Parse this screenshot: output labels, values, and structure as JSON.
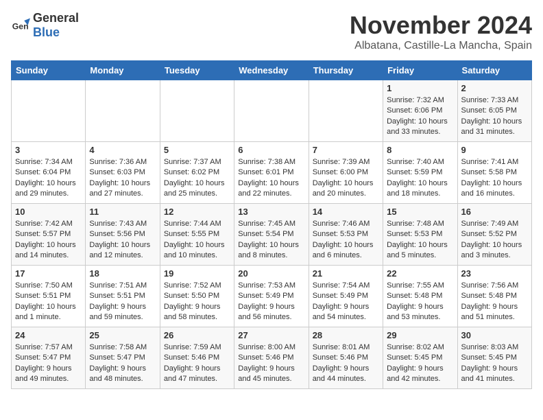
{
  "logo": {
    "general": "General",
    "blue": "Blue"
  },
  "header": {
    "month": "November 2024",
    "location": "Albatana, Castille-La Mancha, Spain"
  },
  "weekdays": [
    "Sunday",
    "Monday",
    "Tuesday",
    "Wednesday",
    "Thursday",
    "Friday",
    "Saturday"
  ],
  "weeks": [
    [
      {
        "day": "",
        "info": ""
      },
      {
        "day": "",
        "info": ""
      },
      {
        "day": "",
        "info": ""
      },
      {
        "day": "",
        "info": ""
      },
      {
        "day": "",
        "info": ""
      },
      {
        "day": "1",
        "info": "Sunrise: 7:32 AM\nSunset: 6:06 PM\nDaylight: 10 hours and 33 minutes."
      },
      {
        "day": "2",
        "info": "Sunrise: 7:33 AM\nSunset: 6:05 PM\nDaylight: 10 hours and 31 minutes."
      }
    ],
    [
      {
        "day": "3",
        "info": "Sunrise: 7:34 AM\nSunset: 6:04 PM\nDaylight: 10 hours and 29 minutes."
      },
      {
        "day": "4",
        "info": "Sunrise: 7:36 AM\nSunset: 6:03 PM\nDaylight: 10 hours and 27 minutes."
      },
      {
        "day": "5",
        "info": "Sunrise: 7:37 AM\nSunset: 6:02 PM\nDaylight: 10 hours and 25 minutes."
      },
      {
        "day": "6",
        "info": "Sunrise: 7:38 AM\nSunset: 6:01 PM\nDaylight: 10 hours and 22 minutes."
      },
      {
        "day": "7",
        "info": "Sunrise: 7:39 AM\nSunset: 6:00 PM\nDaylight: 10 hours and 20 minutes."
      },
      {
        "day": "8",
        "info": "Sunrise: 7:40 AM\nSunset: 5:59 PM\nDaylight: 10 hours and 18 minutes."
      },
      {
        "day": "9",
        "info": "Sunrise: 7:41 AM\nSunset: 5:58 PM\nDaylight: 10 hours and 16 minutes."
      }
    ],
    [
      {
        "day": "10",
        "info": "Sunrise: 7:42 AM\nSunset: 5:57 PM\nDaylight: 10 hours and 14 minutes."
      },
      {
        "day": "11",
        "info": "Sunrise: 7:43 AM\nSunset: 5:56 PM\nDaylight: 10 hours and 12 minutes."
      },
      {
        "day": "12",
        "info": "Sunrise: 7:44 AM\nSunset: 5:55 PM\nDaylight: 10 hours and 10 minutes."
      },
      {
        "day": "13",
        "info": "Sunrise: 7:45 AM\nSunset: 5:54 PM\nDaylight: 10 hours and 8 minutes."
      },
      {
        "day": "14",
        "info": "Sunrise: 7:46 AM\nSunset: 5:53 PM\nDaylight: 10 hours and 6 minutes."
      },
      {
        "day": "15",
        "info": "Sunrise: 7:48 AM\nSunset: 5:53 PM\nDaylight: 10 hours and 5 minutes."
      },
      {
        "day": "16",
        "info": "Sunrise: 7:49 AM\nSunset: 5:52 PM\nDaylight: 10 hours and 3 minutes."
      }
    ],
    [
      {
        "day": "17",
        "info": "Sunrise: 7:50 AM\nSunset: 5:51 PM\nDaylight: 10 hours and 1 minute."
      },
      {
        "day": "18",
        "info": "Sunrise: 7:51 AM\nSunset: 5:51 PM\nDaylight: 9 hours and 59 minutes."
      },
      {
        "day": "19",
        "info": "Sunrise: 7:52 AM\nSunset: 5:50 PM\nDaylight: 9 hours and 58 minutes."
      },
      {
        "day": "20",
        "info": "Sunrise: 7:53 AM\nSunset: 5:49 PM\nDaylight: 9 hours and 56 minutes."
      },
      {
        "day": "21",
        "info": "Sunrise: 7:54 AM\nSunset: 5:49 PM\nDaylight: 9 hours and 54 minutes."
      },
      {
        "day": "22",
        "info": "Sunrise: 7:55 AM\nSunset: 5:48 PM\nDaylight: 9 hours and 53 minutes."
      },
      {
        "day": "23",
        "info": "Sunrise: 7:56 AM\nSunset: 5:48 PM\nDaylight: 9 hours and 51 minutes."
      }
    ],
    [
      {
        "day": "24",
        "info": "Sunrise: 7:57 AM\nSunset: 5:47 PM\nDaylight: 9 hours and 49 minutes."
      },
      {
        "day": "25",
        "info": "Sunrise: 7:58 AM\nSunset: 5:47 PM\nDaylight: 9 hours and 48 minutes."
      },
      {
        "day": "26",
        "info": "Sunrise: 7:59 AM\nSunset: 5:46 PM\nDaylight: 9 hours and 47 minutes."
      },
      {
        "day": "27",
        "info": "Sunrise: 8:00 AM\nSunset: 5:46 PM\nDaylight: 9 hours and 45 minutes."
      },
      {
        "day": "28",
        "info": "Sunrise: 8:01 AM\nSunset: 5:46 PM\nDaylight: 9 hours and 44 minutes."
      },
      {
        "day": "29",
        "info": "Sunrise: 8:02 AM\nSunset: 5:45 PM\nDaylight: 9 hours and 42 minutes."
      },
      {
        "day": "30",
        "info": "Sunrise: 8:03 AM\nSunset: 5:45 PM\nDaylight: 9 hours and 41 minutes."
      }
    ]
  ]
}
